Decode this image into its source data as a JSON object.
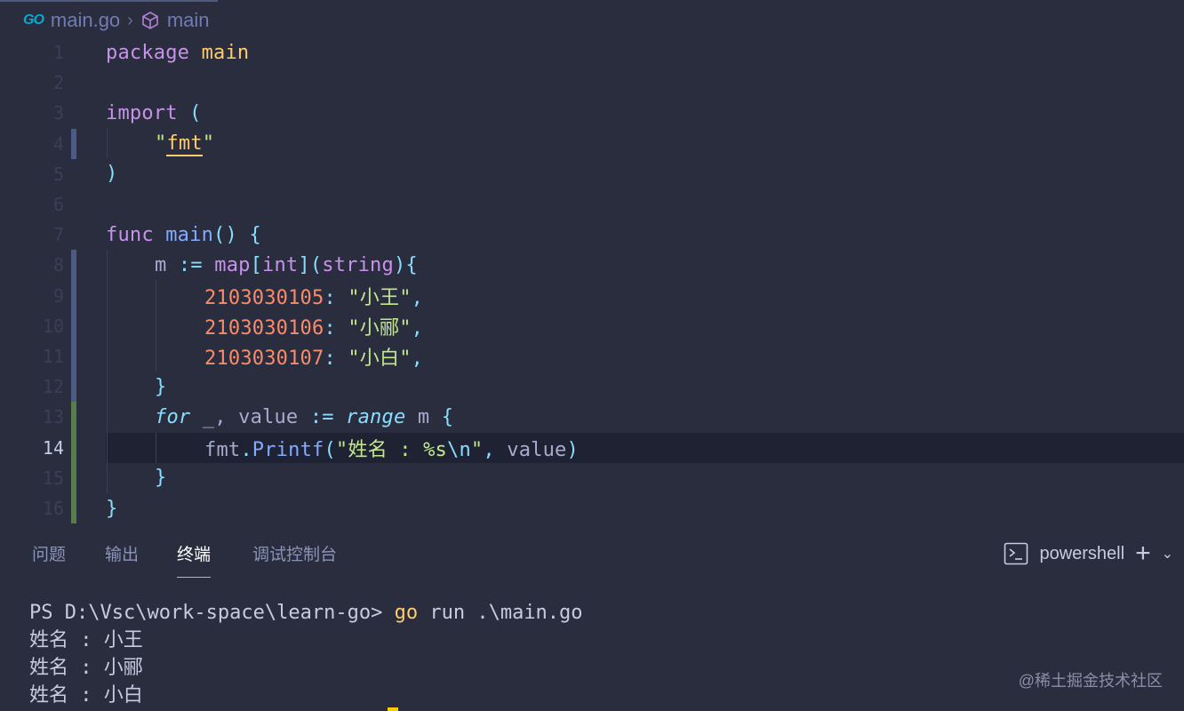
{
  "breadcrumb": {
    "go_icon": "GO",
    "file": "main.go",
    "symbol": "main"
  },
  "editor": {
    "current_line": 14,
    "lines": [
      {
        "n": "1"
      },
      {
        "n": "2"
      },
      {
        "n": "3"
      },
      {
        "n": "4"
      },
      {
        "n": "5"
      },
      {
        "n": "6"
      },
      {
        "n": "7"
      },
      {
        "n": "8"
      },
      {
        "n": "9"
      },
      {
        "n": "10"
      },
      {
        "n": "11"
      },
      {
        "n": "12"
      },
      {
        "n": "13"
      },
      {
        "n": "14"
      },
      {
        "n": "15"
      },
      {
        "n": "16"
      }
    ],
    "code": {
      "l1": {
        "kw": "package",
        "name": "main"
      },
      "l3": {
        "kw": "import",
        "paren": "("
      },
      "l4": {
        "q1": "\"",
        "pkg": "fmt",
        "q2": "\""
      },
      "l5": {
        "paren": ")"
      },
      "l7": {
        "kw": "func",
        "name": "main",
        "rest": "() {"
      },
      "l8": {
        "var": "m",
        "op": ":=",
        "map": "map",
        "b1": "[",
        "t1": "int",
        "b2": "](",
        "t2": "string",
        "b3": "){"
      },
      "l9": {
        "num": "2103030105",
        "colon": ":",
        "str": "\"小王\"",
        "comma": ","
      },
      "l10": {
        "num": "2103030106",
        "colon": ":",
        "str": "\"小郦\"",
        "comma": ","
      },
      "l11": {
        "num": "2103030107",
        "colon": ":",
        "str": "\"小白\"",
        "comma": ","
      },
      "l12": {
        "brace": "}"
      },
      "l13": {
        "kw": "for",
        "under": "_,",
        "var": "value",
        "op": ":=",
        "range": "range",
        "m": "m",
        "brace": "{"
      },
      "l14": {
        "pkg": "fmt",
        "dot": ".",
        "fn": "Printf",
        "p1": "(",
        "str": "\"姓名 : %s",
        "esc": "\\n",
        "str2": "\"",
        "comma": ",",
        "arg": "value",
        "p2": ")"
      },
      "l15": {
        "brace": "}"
      },
      "l16": {
        "brace": "}"
      }
    }
  },
  "panel": {
    "tabs": [
      "问题",
      "输出",
      "终端",
      "调试控制台"
    ],
    "active_tab": "终端",
    "shell": "powershell",
    "plus": "+",
    "chevron": "⌄"
  },
  "terminal": {
    "prompt": "PS D:\\Vsc\\work-space\\learn-go> ",
    "cmd_go": "go",
    "cmd_rest": " run .\\main.go",
    "output": [
      "姓名 : 小王",
      "姓名 : 小郦",
      "姓名 : 小白"
    ]
  },
  "watermark": "@稀土掘金技术社区",
  "colors": {
    "background": "#292d3e",
    "keyword": "#c792ea",
    "function": "#82aaff",
    "string": "#c3e88d",
    "number": "#f78c6c",
    "punctuation": "#89ddff",
    "package": "#ffcb6b"
  }
}
